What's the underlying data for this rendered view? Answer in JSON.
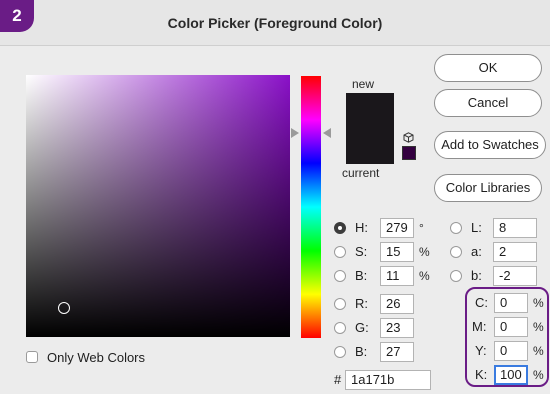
{
  "badge": "2",
  "dialog": {
    "title": "Color Picker (Foreground Color)"
  },
  "preview": {
    "new_label": "new",
    "current_label": "current",
    "color": "#1a171b",
    "web_safe_color": "#33003f"
  },
  "buttons": {
    "ok": "OK",
    "cancel": "Cancel",
    "add_to_swatches": "Add to Swatches",
    "color_libraries": "Color Libraries"
  },
  "hsb": {
    "h": {
      "label": "H:",
      "value": "279",
      "unit": "°"
    },
    "s": {
      "label": "S:",
      "value": "15",
      "unit": "%"
    },
    "b": {
      "label": "B:",
      "value": "11",
      "unit": "%"
    }
  },
  "rgb": {
    "r": {
      "label": "R:",
      "value": "26"
    },
    "g": {
      "label": "G:",
      "value": "23"
    },
    "b": {
      "label": "B:",
      "value": "27"
    }
  },
  "lab": {
    "l": {
      "label": "L:",
      "value": "8"
    },
    "a": {
      "label": "a:",
      "value": "2"
    },
    "b": {
      "label": "b:",
      "value": "-2"
    }
  },
  "cmyk": {
    "c": {
      "label": "C:",
      "value": "0",
      "unit": "%"
    },
    "m": {
      "label": "M:",
      "value": "0",
      "unit": "%"
    },
    "y": {
      "label": "Y:",
      "value": "0",
      "unit": "%"
    },
    "k": {
      "label": "K:",
      "value": "100",
      "unit": "%"
    }
  },
  "hex": {
    "label": "#",
    "value": "1a171b"
  },
  "only_web_colors": {
    "label": "Only Web Colors",
    "checked": false
  },
  "colors": {
    "accent": "#6a1c86",
    "focus": "#3a7be0"
  }
}
